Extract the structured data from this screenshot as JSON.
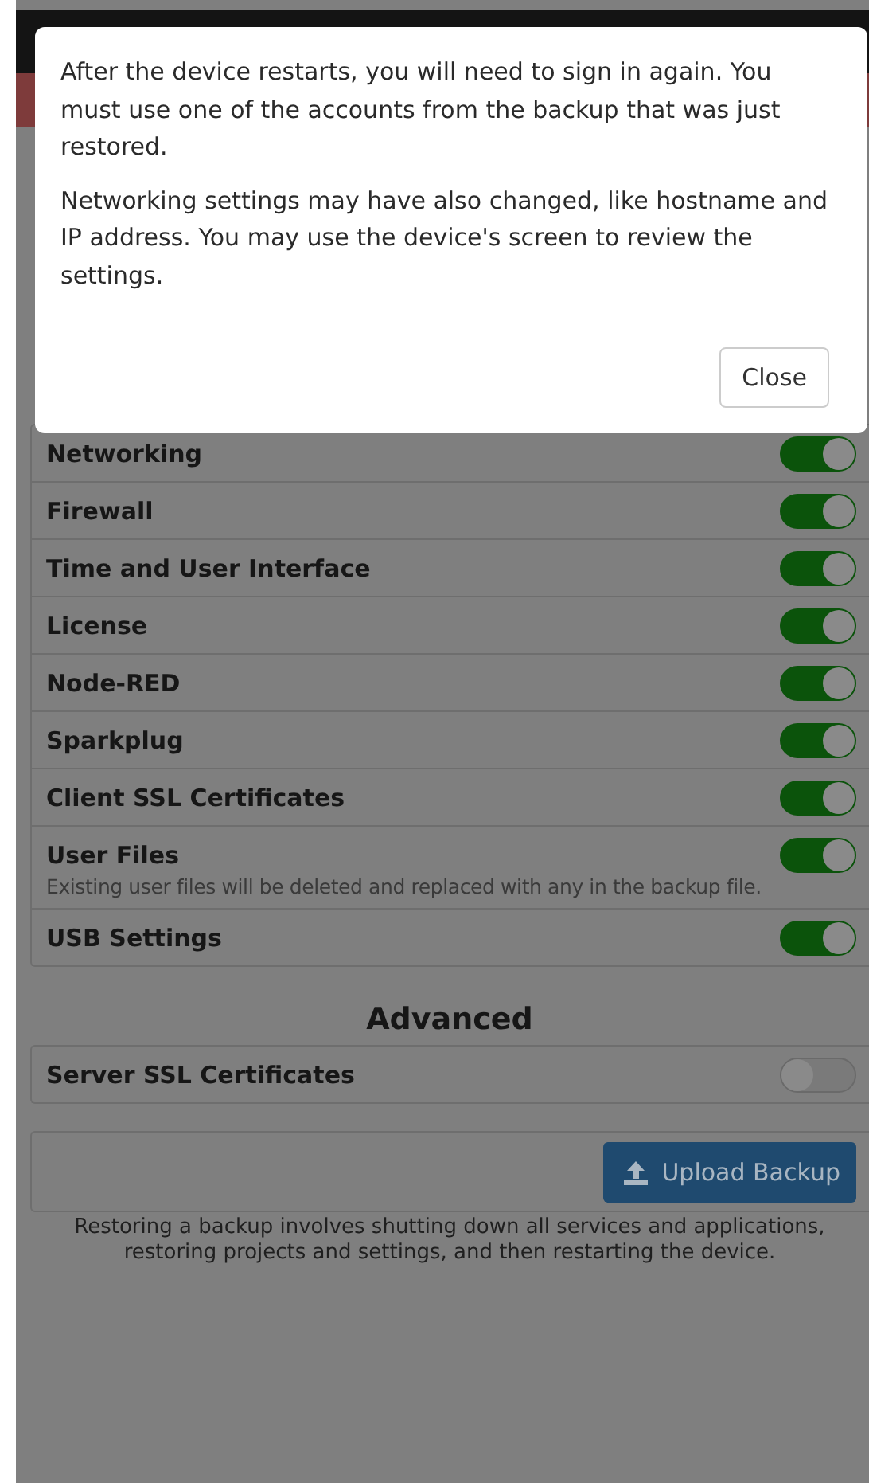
{
  "modal": {
    "paragraphs": [
      "After the device restarts, you will need to sign in again. You must use one of the accounts from the backup that was just restored.",
      "Networking settings may have also changed, like hostname and IP address. You may use the device's screen to review the settings."
    ],
    "close_button": "Close"
  },
  "restore_items": [
    {
      "label": "Networking",
      "on": true
    },
    {
      "label": "Firewall",
      "on": true
    },
    {
      "label": "Time and User Interface",
      "on": true
    },
    {
      "label": "License",
      "on": true
    },
    {
      "label": "Node-RED",
      "on": true
    },
    {
      "label": "Sparkplug",
      "on": true
    },
    {
      "label": "Client SSL Certificates",
      "on": true
    },
    {
      "label": "User Files",
      "on": true,
      "note": "Existing user files will be deleted and replaced with any in the backup file."
    },
    {
      "label": "USB Settings",
      "on": true
    }
  ],
  "advanced": {
    "heading": "Advanced",
    "items": [
      {
        "label": "Server SSL Certificates",
        "on": false
      }
    ]
  },
  "upload_button": "Upload Backup",
  "restore_note": "Restoring a backup involves shutting down all services and applications, restoring projects and settings, and then restarting the device."
}
